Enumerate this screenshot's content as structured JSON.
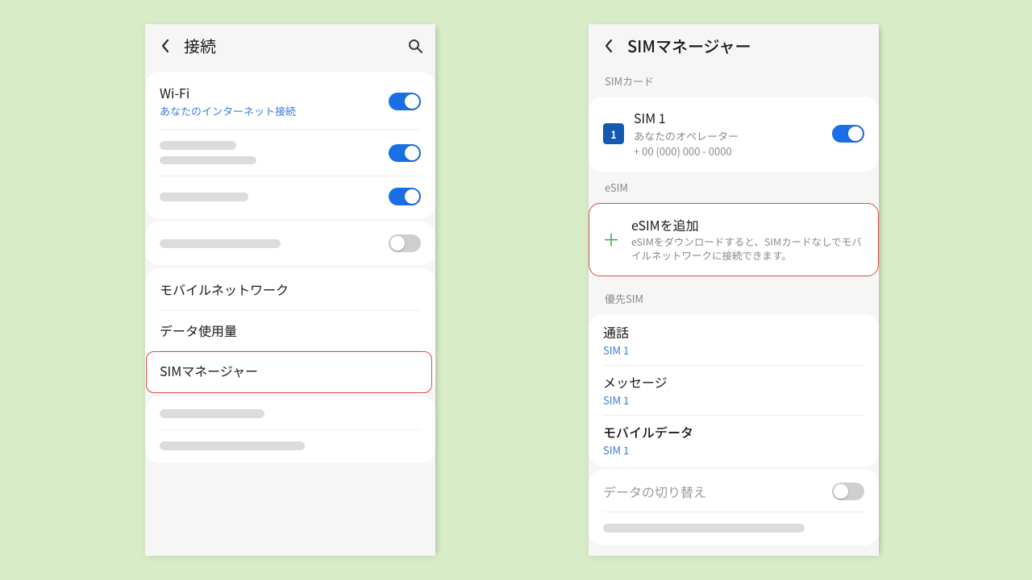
{
  "left": {
    "title": "接続",
    "wifi": {
      "title": "Wi-Fi",
      "sub": "あなたのインターネット接続"
    },
    "mobile_networks": "モバイルネットワーク",
    "data_usage": "データ使用量",
    "sim_manager": "SIMマネージャー"
  },
  "right": {
    "title": "SIMマネージャー",
    "sim_cards_label": "SIMカード",
    "sim1": {
      "badge": "1",
      "title": "SIM 1",
      "operator": "あなたのオペレーター",
      "number": "+ 00 (000) 000 - 0000"
    },
    "esim_label": "eSIM",
    "add_esim": {
      "title": "eSIMを追加",
      "sub": "eSIMをダウンロードすると、SIMカードなしでモバイルネットワークに接続できます。"
    },
    "preferred_label": "優先SIM",
    "calls": {
      "title": "通話",
      "value": "SIM 1"
    },
    "msgs": {
      "title": "メッセージ",
      "value": "SIM 1"
    },
    "mdata": {
      "title": "モバイルデータ",
      "value": "SIM 1"
    },
    "data_switch": "データの切り替え"
  }
}
